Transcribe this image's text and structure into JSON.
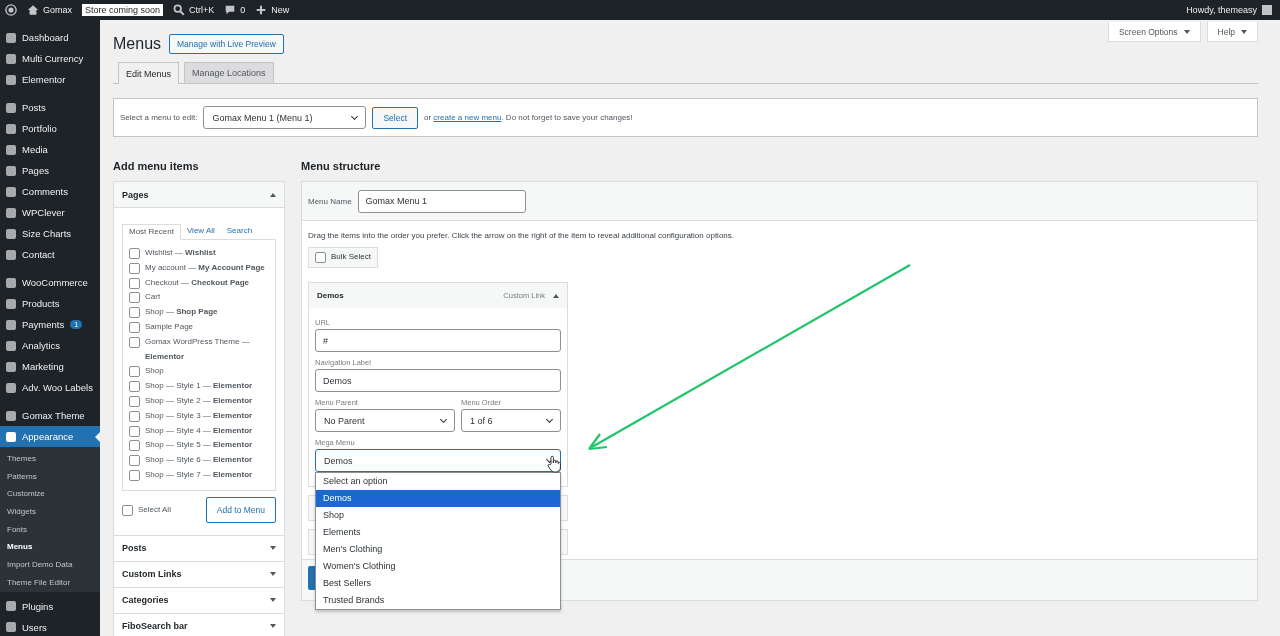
{
  "admin_bar": {
    "site": "Gomax",
    "badge": "Store coming soon",
    "search": "Ctrl+K",
    "comments": "0",
    "new": "New",
    "greeting": "Howdy, themeasy"
  },
  "sidebar": {
    "groups": [
      {
        "items": [
          {
            "label": "Dashboard",
            "selected": false
          },
          {
            "label": "Multi Currency",
            "selected": false
          },
          {
            "label": "Elementor",
            "selected": false
          }
        ]
      },
      {
        "items": [
          {
            "label": "Posts",
            "selected": false
          },
          {
            "label": "Portfolio",
            "selected": false
          },
          {
            "label": "Media",
            "selected": false
          },
          {
            "label": "Pages",
            "selected": false
          },
          {
            "label": "Comments",
            "selected": false
          },
          {
            "label": "WPClever",
            "selected": false
          },
          {
            "label": "Size Charts",
            "selected": false
          },
          {
            "label": "Contact",
            "selected": false
          }
        ]
      },
      {
        "items": [
          {
            "label": "WooCommerce",
            "selected": false
          },
          {
            "label": "Products",
            "selected": false
          },
          {
            "label": "Payments",
            "selected": false,
            "badge": "1"
          },
          {
            "label": "Analytics",
            "selected": false
          },
          {
            "label": "Marketing",
            "selected": false
          },
          {
            "label": "Adv. Woo Labels",
            "selected": false
          }
        ]
      },
      {
        "items": [
          {
            "label": "Gomax Theme",
            "selected": false
          },
          {
            "label": "Appearance",
            "selected": true,
            "children": [
              {
                "label": "Themes",
                "selected": false
              },
              {
                "label": "Patterns",
                "selected": false
              },
              {
                "label": "Customize",
                "selected": false
              },
              {
                "label": "Widgets",
                "selected": false
              },
              {
                "label": "Fonts",
                "selected": false
              },
              {
                "label": "Menus",
                "selected": true
              },
              {
                "label": "Import Demo Data",
                "selected": false
              },
              {
                "label": "Theme File Editor",
                "selected": false
              }
            ]
          }
        ]
      },
      {
        "items": [
          {
            "label": "Plugins",
            "selected": false
          },
          {
            "label": "Users",
            "selected": false
          }
        ]
      }
    ]
  },
  "screen_options": "Screen Options",
  "help": "Help",
  "page_title": "Menus",
  "live_preview_button": "Manage with Live Preview",
  "tabs": [
    {
      "label": "Edit Menus",
      "selected": true
    },
    {
      "label": "Manage Locations",
      "selected": false
    }
  ],
  "select_menu": {
    "label": "Select a menu to edit:",
    "value": "Gomax Menu 1 (Menu 1)",
    "button": "Select",
    "note_before": "or ",
    "link": "create a new menu",
    "note_after": ". Do not forget to save your changes!"
  },
  "add_items": {
    "title": "Add menu items",
    "sections": [
      {
        "title": "Pages",
        "expanded": true,
        "tabs": [
          {
            "label": "Most Recent",
            "selected": true
          },
          {
            "label": "View All",
            "selected": false
          },
          {
            "label": "Search",
            "selected": false
          }
        ],
        "pages": [
          {
            "label": "Wishlist — **Wishlist**",
            "checked": false
          },
          {
            "label": "My account — **My Account Page**",
            "checked": false
          },
          {
            "label": "Checkout — **Checkout Page**",
            "checked": false
          },
          {
            "label": "Cart",
            "checked": false
          },
          {
            "label": "Shop — **Shop Page**",
            "checked": false
          },
          {
            "label": "Sample Page",
            "checked": false
          },
          {
            "label": "Gomax WordPress Theme — **Elementor**",
            "checked": false
          },
          {
            "label": "Shop",
            "checked": false
          },
          {
            "label": "Shop — Style 1 — **Elementor**",
            "checked": false
          },
          {
            "label": "Shop — Style 2 — **Elementor**",
            "checked": false
          },
          {
            "label": "Shop — Style 3 — **Elementor**",
            "checked": false
          },
          {
            "label": "Shop — Style 4 — **Elementor**",
            "checked": false
          },
          {
            "label": "Shop — Style 5 — **Elementor**",
            "checked": false
          },
          {
            "label": "Shop — Style 6 — **Elementor**",
            "checked": false
          },
          {
            "label": "Shop — Style 7 — **Elementor**",
            "checked": false
          }
        ],
        "select_all": {
          "label": "Select All",
          "checked": false
        },
        "button": "Add to Menu"
      },
      {
        "title": "Posts",
        "expanded": false
      },
      {
        "title": "Custom Links",
        "expanded": false
      },
      {
        "title": "Categories",
        "expanded": false
      },
      {
        "title": "FiboSearch bar",
        "expanded": false
      }
    ]
  },
  "structure": {
    "title": "Menu structure",
    "name_label": "Menu Name",
    "name_value": "Gomax Menu 1",
    "hint": "Drag the items into the order you prefer. Click the arrow on the right of the item to reveal additional configuration options.",
    "bulk_select": {
      "label": "Bulk Select",
      "checked": false
    },
    "item": {
      "title": "Demos",
      "type": "Custom Link",
      "expanded": true,
      "url_label": "URL",
      "url": "#",
      "nav_label_label": "Navigation Label",
      "nav_label": "Demos",
      "parent_label": "Menu Parent",
      "parent": "No Parent",
      "order_label": "Menu Order",
      "order": "1 of 6",
      "mega_label": "Mega Menu",
      "mega_value": "Demos",
      "mega_open": true,
      "options": [
        {
          "label": "Select an option",
          "selected": false
        },
        {
          "label": "Demos",
          "selected": true
        },
        {
          "label": "Shop",
          "selected": false
        },
        {
          "label": "Elements",
          "selected": false
        },
        {
          "label": "Men's Clothing",
          "selected": false
        },
        {
          "label": "Women's Clothing",
          "selected": false
        },
        {
          "label": "Best Sellers",
          "selected": false
        },
        {
          "label": "Trusted Brands",
          "selected": false
        }
      ]
    }
  }
}
